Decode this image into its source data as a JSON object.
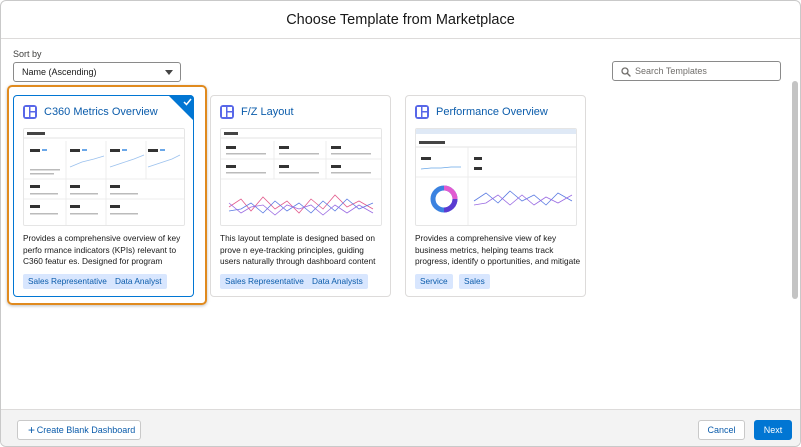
{
  "header": {
    "title": "Choose Template from Marketplace"
  },
  "sort": {
    "label": "Sort by",
    "selected": "Name (Ascending)"
  },
  "search": {
    "placeholder": "Search Templates"
  },
  "cards": [
    {
      "title": "C360 Metrics Overview",
      "description": "Provides a comprehensive overview of key perfo rmance indicators (KPIs) relevant to C360 featur es. Designed for program managers and stak…",
      "tags": [
        "Sales Representative",
        "Data Analyst"
      ],
      "selected": true
    },
    {
      "title": "F/Z Layout",
      "description": "This layout template is designed based on prove n eye-tracking principles, guiding users naturally through dashboard content for maximized co…",
      "tags": [
        "Sales Representative",
        "Data Analysts"
      ],
      "selected": false
    },
    {
      "title": "Performance Overview",
      "description": "Provides a comprehensive view of key business metrics, helping teams track progress, identify o pportunities, and mitigate risks. Designed for s…",
      "tags": [
        "Service",
        "Sales"
      ],
      "selected": false
    }
  ],
  "footer": {
    "create_blank_label": "Create Blank Dashboard",
    "cancel_label": "Cancel",
    "next_label": "Next"
  },
  "colors": {
    "brand": "#0176d3",
    "link": "#0b5cab",
    "tag_bg": "#d8e6fe",
    "highlight": "#e08a1e",
    "icon_bg": "#5867e8"
  },
  "icons": {
    "search": "search-icon",
    "dashboard": "dashboard-icon",
    "check": "check-icon",
    "plus": "plus-icon",
    "caret": "caret-down-icon"
  }
}
